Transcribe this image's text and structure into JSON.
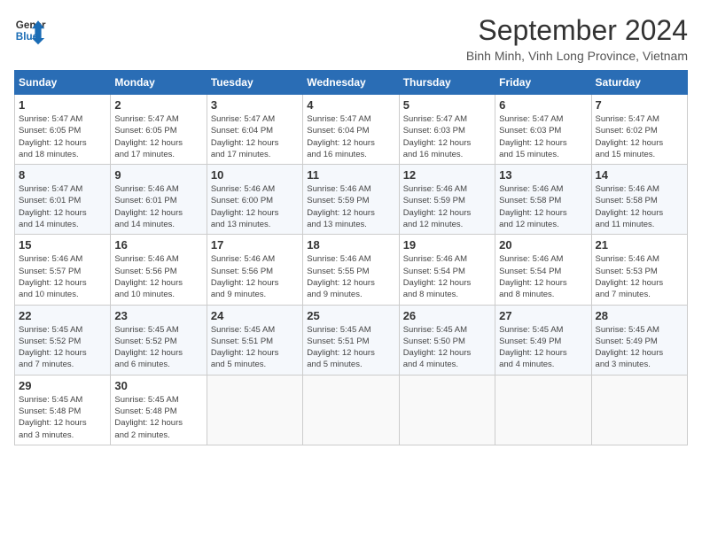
{
  "logo": {
    "line1": "General",
    "line2": "Blue"
  },
  "title": "September 2024",
  "subtitle": "Binh Minh, Vinh Long Province, Vietnam",
  "days_header": [
    "Sunday",
    "Monday",
    "Tuesday",
    "Wednesday",
    "Thursday",
    "Friday",
    "Saturday"
  ],
  "weeks": [
    [
      {
        "day": 1,
        "info": "Sunrise: 5:47 AM\nSunset: 6:05 PM\nDaylight: 12 hours\nand 18 minutes."
      },
      {
        "day": 2,
        "info": "Sunrise: 5:47 AM\nSunset: 6:05 PM\nDaylight: 12 hours\nand 17 minutes."
      },
      {
        "day": 3,
        "info": "Sunrise: 5:47 AM\nSunset: 6:04 PM\nDaylight: 12 hours\nand 17 minutes."
      },
      {
        "day": 4,
        "info": "Sunrise: 5:47 AM\nSunset: 6:04 PM\nDaylight: 12 hours\nand 16 minutes."
      },
      {
        "day": 5,
        "info": "Sunrise: 5:47 AM\nSunset: 6:03 PM\nDaylight: 12 hours\nand 16 minutes."
      },
      {
        "day": 6,
        "info": "Sunrise: 5:47 AM\nSunset: 6:03 PM\nDaylight: 12 hours\nand 15 minutes."
      },
      {
        "day": 7,
        "info": "Sunrise: 5:47 AM\nSunset: 6:02 PM\nDaylight: 12 hours\nand 15 minutes."
      }
    ],
    [
      {
        "day": 8,
        "info": "Sunrise: 5:47 AM\nSunset: 6:01 PM\nDaylight: 12 hours\nand 14 minutes."
      },
      {
        "day": 9,
        "info": "Sunrise: 5:46 AM\nSunset: 6:01 PM\nDaylight: 12 hours\nand 14 minutes."
      },
      {
        "day": 10,
        "info": "Sunrise: 5:46 AM\nSunset: 6:00 PM\nDaylight: 12 hours\nand 13 minutes."
      },
      {
        "day": 11,
        "info": "Sunrise: 5:46 AM\nSunset: 5:59 PM\nDaylight: 12 hours\nand 13 minutes."
      },
      {
        "day": 12,
        "info": "Sunrise: 5:46 AM\nSunset: 5:59 PM\nDaylight: 12 hours\nand 12 minutes."
      },
      {
        "day": 13,
        "info": "Sunrise: 5:46 AM\nSunset: 5:58 PM\nDaylight: 12 hours\nand 12 minutes."
      },
      {
        "day": 14,
        "info": "Sunrise: 5:46 AM\nSunset: 5:58 PM\nDaylight: 12 hours\nand 11 minutes."
      }
    ],
    [
      {
        "day": 15,
        "info": "Sunrise: 5:46 AM\nSunset: 5:57 PM\nDaylight: 12 hours\nand 10 minutes."
      },
      {
        "day": 16,
        "info": "Sunrise: 5:46 AM\nSunset: 5:56 PM\nDaylight: 12 hours\nand 10 minutes."
      },
      {
        "day": 17,
        "info": "Sunrise: 5:46 AM\nSunset: 5:56 PM\nDaylight: 12 hours\nand 9 minutes."
      },
      {
        "day": 18,
        "info": "Sunrise: 5:46 AM\nSunset: 5:55 PM\nDaylight: 12 hours\nand 9 minutes."
      },
      {
        "day": 19,
        "info": "Sunrise: 5:46 AM\nSunset: 5:54 PM\nDaylight: 12 hours\nand 8 minutes."
      },
      {
        "day": 20,
        "info": "Sunrise: 5:46 AM\nSunset: 5:54 PM\nDaylight: 12 hours\nand 8 minutes."
      },
      {
        "day": 21,
        "info": "Sunrise: 5:46 AM\nSunset: 5:53 PM\nDaylight: 12 hours\nand 7 minutes."
      }
    ],
    [
      {
        "day": 22,
        "info": "Sunrise: 5:45 AM\nSunset: 5:52 PM\nDaylight: 12 hours\nand 7 minutes."
      },
      {
        "day": 23,
        "info": "Sunrise: 5:45 AM\nSunset: 5:52 PM\nDaylight: 12 hours\nand 6 minutes."
      },
      {
        "day": 24,
        "info": "Sunrise: 5:45 AM\nSunset: 5:51 PM\nDaylight: 12 hours\nand 5 minutes."
      },
      {
        "day": 25,
        "info": "Sunrise: 5:45 AM\nSunset: 5:51 PM\nDaylight: 12 hours\nand 5 minutes."
      },
      {
        "day": 26,
        "info": "Sunrise: 5:45 AM\nSunset: 5:50 PM\nDaylight: 12 hours\nand 4 minutes."
      },
      {
        "day": 27,
        "info": "Sunrise: 5:45 AM\nSunset: 5:49 PM\nDaylight: 12 hours\nand 4 minutes."
      },
      {
        "day": 28,
        "info": "Sunrise: 5:45 AM\nSunset: 5:49 PM\nDaylight: 12 hours\nand 3 minutes."
      }
    ],
    [
      {
        "day": 29,
        "info": "Sunrise: 5:45 AM\nSunset: 5:48 PM\nDaylight: 12 hours\nand 3 minutes."
      },
      {
        "day": 30,
        "info": "Sunrise: 5:45 AM\nSunset: 5:48 PM\nDaylight: 12 hours\nand 2 minutes."
      },
      null,
      null,
      null,
      null,
      null
    ]
  ]
}
